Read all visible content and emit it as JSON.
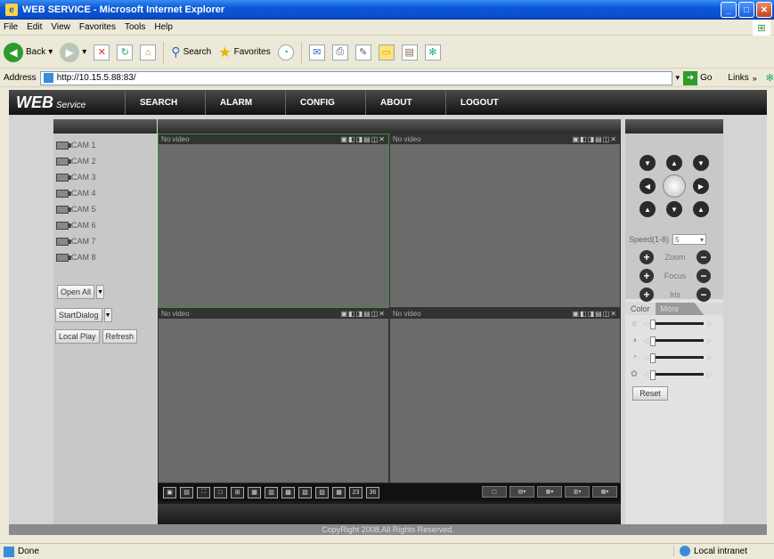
{
  "browser": {
    "title": "WEB SERVICE - Microsoft Internet Explorer",
    "menu": [
      "File",
      "Edit",
      "View",
      "Favorites",
      "Tools",
      "Help"
    ],
    "toolbar": {
      "back": "Back",
      "search": "Search",
      "favorites": "Favorites"
    },
    "address_label": "Address",
    "address_value": "http://10.15.5.88:83/",
    "go_label": "Go",
    "links_label": "Links",
    "status_text": "Done",
    "zone_text": "Local intranet"
  },
  "app": {
    "logo_main": "WEB",
    "logo_sub": "Service",
    "nav": [
      "SEARCH",
      "ALARM",
      "CONFIG",
      "ABOUT",
      "LOGOUT"
    ],
    "cameras": [
      "CAM 1",
      "CAM 2",
      "CAM 3",
      "CAM 4",
      "CAM 5",
      "CAM 6",
      "CAM 7",
      "CAM 8"
    ],
    "open_all": "Open All",
    "start_dialog": "StartDialog",
    "local_play": "Local Play",
    "refresh": "Refresh",
    "cell_label": "No video",
    "split_labels": [
      "",
      "",
      "",
      "",
      "",
      "",
      "",
      "",
      "",
      "",
      "",
      "23",
      "36"
    ],
    "speed_label": "Speed(1-8)",
    "speed_value": "5",
    "zoom": "Zoom",
    "focus": "Focus",
    "iris": "Iris",
    "tab_color": "Color",
    "tab_more": "More",
    "reset": "Reset",
    "copyright": "CopyRight 2008,All Rights Reserved."
  },
  "colors": {
    "active_cell_border": "#3f8f3f",
    "nav_bg": "#1a1a1a"
  }
}
